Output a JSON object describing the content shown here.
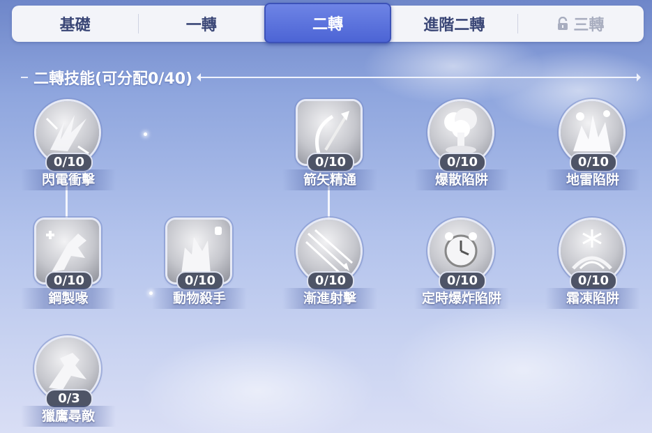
{
  "tabs": [
    {
      "label": "基礎",
      "state": "normal"
    },
    {
      "label": "一轉",
      "state": "normal"
    },
    {
      "label": "二轉",
      "state": "active"
    },
    {
      "label": "進階二轉",
      "state": "normal"
    },
    {
      "label": "三轉",
      "state": "locked",
      "icon": "lock-icon"
    }
  ],
  "section": {
    "title": "二轉技能(可分配0/40)"
  },
  "skills": [
    {
      "name": "閃電衝擊",
      "level": "0/10",
      "icon": "eagle-strike-icon"
    },
    {
      "name": "箭矢精通",
      "level": "0/10",
      "icon": "arrow-mastery-icon"
    },
    {
      "name": "爆散陷阱",
      "level": "0/10",
      "icon": "explosion-trap-icon"
    },
    {
      "name": "地雷陷阱",
      "level": "0/10",
      "icon": "land-mine-icon"
    },
    {
      "name": "鋼製喙",
      "level": "0/10",
      "icon": "steel-beak-icon"
    },
    {
      "name": "動物殺手",
      "level": "0/10",
      "icon": "animal-slayer-icon"
    },
    {
      "name": "漸進射擊",
      "level": "0/10",
      "icon": "progressive-shot-icon"
    },
    {
      "name": "定時爆炸陷阱",
      "level": "0/10",
      "icon": "timer-bomb-trap-icon"
    },
    {
      "name": "霜凍陷阱",
      "level": "0/10",
      "icon": "frost-trap-icon"
    },
    {
      "name": "獵鷹尋敵",
      "level": "0/3",
      "icon": "falcon-seek-icon"
    }
  ]
}
